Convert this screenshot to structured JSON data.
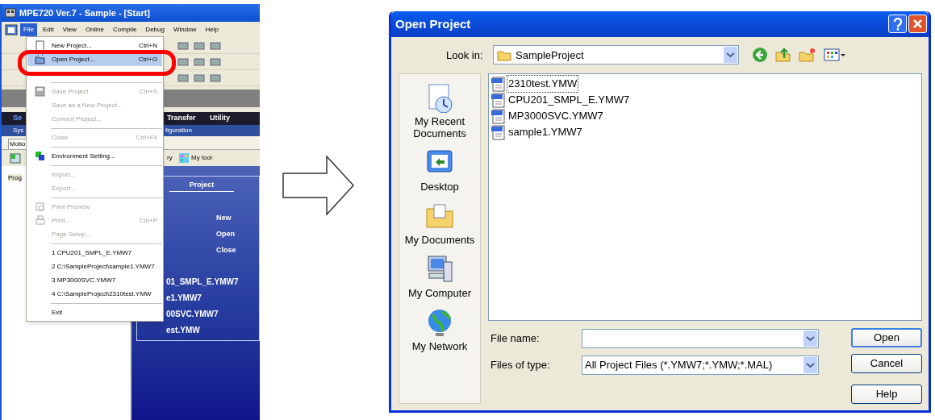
{
  "app_window": {
    "title": "MPE720 Ver.7 - Sample - [Start]",
    "menu_bar": [
      {
        "label": "File",
        "selected": true
      },
      {
        "label": "Edit",
        "selected": false
      },
      {
        "label": "View",
        "selected": false
      },
      {
        "label": "Online",
        "selected": false
      },
      {
        "label": "Compile",
        "selected": false
      },
      {
        "label": "Debug",
        "selected": false
      },
      {
        "label": "Window",
        "selected": false
      },
      {
        "label": "Help",
        "selected": false
      }
    ],
    "tab_row": [
      "Se",
      "Transfer",
      "Utility"
    ],
    "subtab_row": [
      "Sys",
      "figuration"
    ],
    "panel_tab": "Motio",
    "toolbar_texts": [
      "ry",
      "My tool"
    ],
    "side_label": "Prog",
    "start_panel": {
      "header": "Project",
      "actions": [
        "New",
        "Open",
        "Close"
      ],
      "recent_files": [
        "01_SMPL_E.YMW7",
        "e1.YMW7",
        "00SVC.YMW7",
        "est.YMW"
      ]
    }
  },
  "file_menu": [
    {
      "kind": "item",
      "label": "New Project...",
      "shortcut": "Ctrl+N",
      "disabled": false,
      "highlighted": false
    },
    {
      "kind": "item",
      "label": "Open Project...",
      "shortcut": "Ctrl+O",
      "disabled": false,
      "highlighted": true
    },
    {
      "kind": "separator"
    },
    {
      "kind": "item",
      "label": "Save Project",
      "shortcut": "Ctrl+S",
      "disabled": true,
      "highlighted": false
    },
    {
      "kind": "item",
      "label": "Save as a New Project...",
      "disabled": true,
      "highlighted": false
    },
    {
      "kind": "item",
      "label": "Convert Project...",
      "disabled": true,
      "highlighted": false
    },
    {
      "kind": "separator"
    },
    {
      "kind": "item",
      "label": "Close",
      "shortcut": "Ctrl+F4",
      "disabled": true,
      "highlighted": false
    },
    {
      "kind": "separator"
    },
    {
      "kind": "item",
      "label": "Environment Setting...",
      "disabled": false,
      "highlighted": false
    },
    {
      "kind": "separator"
    },
    {
      "kind": "item",
      "label": "Import...",
      "disabled": true,
      "highlighted": false
    },
    {
      "kind": "item",
      "label": "Export...",
      "disabled": true,
      "highlighted": false
    },
    {
      "kind": "separator"
    },
    {
      "kind": "item",
      "label": "Print Preview",
      "disabled": true,
      "highlighted": false
    },
    {
      "kind": "item",
      "label": "Print...",
      "shortcut": "Ctrl+P",
      "disabled": true,
      "highlighted": false
    },
    {
      "kind": "item",
      "label": "Page Setup...",
      "disabled": true,
      "highlighted": false
    },
    {
      "kind": "separator"
    },
    {
      "kind": "item",
      "label": "1 CPU201_SMPL_E.YMW7",
      "disabled": false,
      "highlighted": false
    },
    {
      "kind": "item",
      "label": "2 C:\\SampleProject\\sample1.YMW7",
      "disabled": false,
      "highlighted": false
    },
    {
      "kind": "item",
      "label": "3 MP3000SVC.YMW7",
      "disabled": false,
      "highlighted": false
    },
    {
      "kind": "item",
      "label": "4 C:\\SampleProject\\2310test.YMW",
      "disabled": false,
      "highlighted": false
    },
    {
      "kind": "separator"
    },
    {
      "kind": "item",
      "label": "Exit",
      "disabled": false,
      "highlighted": false
    }
  ],
  "open_dialog": {
    "title": "Open Project",
    "look_in": {
      "label": "Look in:",
      "value": "SampleProject"
    },
    "places": [
      "My Recent Documents",
      "Desktop",
      "My Documents",
      "My Computer",
      "My Network"
    ],
    "files": [
      {
        "name": "2310test.YMW",
        "focused": true
      },
      {
        "name": "CPU201_SMPL_E.YMW7",
        "focused": false
      },
      {
        "name": "MP3000SVC.YMW7",
        "focused": false
      },
      {
        "name": "sample1.YMW7",
        "focused": false
      }
    ],
    "file_name": {
      "label": "File name:"
    },
    "files_of_type": {
      "label": "Files of type:",
      "value": "All Project Files (*.YMW7;*.YMW;*.MAL)"
    },
    "buttons": [
      {
        "label": "Open",
        "default": true
      },
      {
        "label": "Cancel",
        "default": false
      },
      {
        "label": "Help",
        "default": false
      }
    ]
  }
}
